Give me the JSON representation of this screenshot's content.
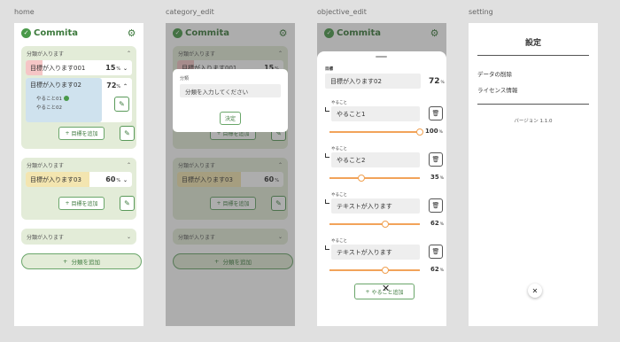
{
  "frames": {
    "home": "home",
    "category_edit": "category_edit",
    "objective_edit": "objective_edit",
    "setting": "setting"
  },
  "app": {
    "title": "Commita"
  },
  "home": {
    "categories": [
      {
        "name": "分類が入ります",
        "objectives": [
          {
            "name": "目標が入ります001",
            "percent": "15",
            "unit": "%"
          },
          {
            "name": "目標が入ります02",
            "percent": "72",
            "unit": "%",
            "todos": [
              "やること01",
              "やること02"
            ]
          }
        ]
      },
      {
        "name": "分類が入ります",
        "objectives": [
          {
            "name": "目標が入ります03",
            "percent": "60",
            "unit": "%"
          }
        ]
      },
      {
        "name": "分類が入ります",
        "objectives": []
      }
    ],
    "add_objective": "目標を追加",
    "add_category": "分類を追加"
  },
  "category_edit": {
    "dialog_label": "分類",
    "input_placeholder": "分類を入力してください",
    "ok_label": "決定"
  },
  "objective_edit": {
    "objective_label": "目標",
    "objective_value": "目標が入ります02",
    "objective_percent": "72",
    "todo_label": "やること",
    "todos": [
      {
        "label": "やること",
        "text": "やること1",
        "percent": "100",
        "unit": "%",
        "progress": 1.0
      },
      {
        "label": "やること",
        "text": "やること2",
        "percent": "35",
        "unit": "%",
        "progress": 0.35
      },
      {
        "label": "やること",
        "text": "テキストが入ります",
        "percent": "62",
        "unit": "%",
        "progress": 0.62
      },
      {
        "label": "やること",
        "text": "テキストが入ります",
        "percent": "62",
        "unit": "%",
        "progress": 0.62
      }
    ],
    "add_label": "やること追加"
  },
  "setting": {
    "title": "設定",
    "items": [
      "データの削除",
      "ライセンス情報"
    ],
    "version": "バージョン 1.1.0"
  },
  "colors": {
    "primary": "#3d7a3d",
    "category_bg": "#e3ecd8",
    "fill_red": "#f5c6c6",
    "fill_blue": "#cfe2ee",
    "fill_yellow": "#f3e5b0",
    "slider": "#f2a35a"
  }
}
